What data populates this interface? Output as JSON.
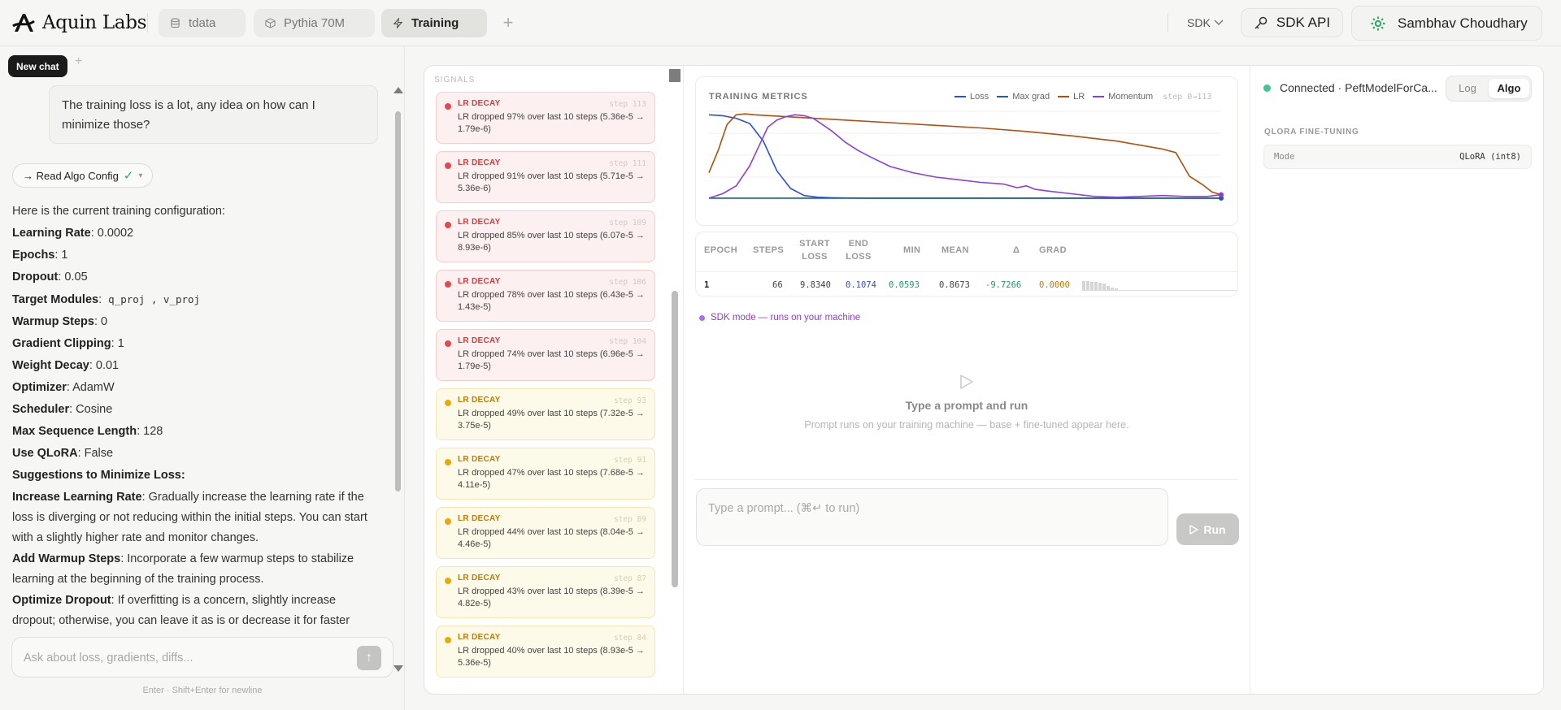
{
  "app": {
    "brand": "Aquin Labs",
    "tabs": [
      {
        "label": "tdata",
        "icon": "database-icon"
      },
      {
        "label": "Pythia 70M",
        "icon": "cube-icon"
      },
      {
        "label": "Training",
        "icon": "bolt-icon"
      }
    ],
    "tab_add": "+",
    "sdk_dropdown": "SDK",
    "sdk_api": "SDK API",
    "user_name": "Sambhav Choudhary"
  },
  "chat": {
    "new_chat": "New chat",
    "new_plus": "+",
    "user_message": "The training loss is a lot, any idea on how can I minimize those?",
    "tool_call": {
      "label": "→ Read Algo Config",
      "status": "✓",
      "chevron": "▾"
    },
    "intro": "Here is the current training configuration:",
    "config": [
      {
        "k": "Learning Rate",
        "v": ": 0.0002"
      },
      {
        "k": "Epochs",
        "v": ": 1"
      },
      {
        "k": "Dropout",
        "v": ": 0.05"
      },
      {
        "k": "Target Modules",
        "v": ":"
      },
      {
        "k": "Warmup Steps",
        "v": ": 0"
      },
      {
        "k": "Gradient Clipping",
        "v": ": 1"
      },
      {
        "k": "Weight Decay",
        "v": ": 0.01"
      },
      {
        "k": "Optimizer",
        "v": ": AdamW"
      },
      {
        "k": "Scheduler",
        "v": ": Cosine"
      },
      {
        "k": "Max Sequence Length",
        "v": ": 128"
      },
      {
        "k": "Use QLoRA",
        "v": ": False"
      }
    ],
    "target_modules_code": "q_proj , v_proj",
    "suggestions_heading": "Suggestions to Minimize Loss:",
    "suggestions": [
      {
        "k": "Increase Learning Rate",
        "v": ": Gradually increase the learning rate if the loss is diverging or not reducing within the initial steps. You can start with a slightly higher rate and monitor changes."
      },
      {
        "k": "Add Warmup Steps",
        "v": ": Incorporate a few warmup steps to stabilize learning at the beginning of the training process."
      },
      {
        "k": "Optimize Dropout",
        "v": ": If overfitting is a concern, slightly increase dropout; otherwise, you can leave it as is or decrease it for faster"
      }
    ],
    "input_placeholder": "Ask about loss, gradients, diffs...",
    "send": "↑",
    "hint": "Enter · Shift+Enter for newline"
  },
  "signals": {
    "title": "SIGNALS",
    "items": [
      {
        "kind": "LR DECAY",
        "step": "step 113",
        "msg": "LR dropped 97% over last 10 steps (5.36e-5 → 1.79e-6)",
        "level": "red"
      },
      {
        "kind": "LR DECAY",
        "step": "step 111",
        "msg": "LR dropped 91% over last 10 steps (5.71e-5 → 5.36e-6)",
        "level": "red"
      },
      {
        "kind": "LR DECAY",
        "step": "step 109",
        "msg": "LR dropped 85% over last 10 steps (6.07e-5 → 8.93e-6)",
        "level": "red"
      },
      {
        "kind": "LR DECAY",
        "step": "step 106",
        "msg": "LR dropped 78% over last 10 steps (6.43e-5 → 1.43e-5)",
        "level": "red"
      },
      {
        "kind": "LR DECAY",
        "step": "step 104",
        "msg": "LR dropped 74% over last 10 steps (6.96e-5 → 1.79e-5)",
        "level": "red"
      },
      {
        "kind": "LR DECAY",
        "step": "step 93",
        "msg": "LR dropped 49% over last 10 steps (7.32e-5 → 3.75e-5)",
        "level": "yellow"
      },
      {
        "kind": "LR DECAY",
        "step": "step 91",
        "msg": "LR dropped 47% over last 10 steps (7.68e-5 → 4.11e-5)",
        "level": "yellow"
      },
      {
        "kind": "LR DECAY",
        "step": "step 89",
        "msg": "LR dropped 44% over last 10 steps (8.04e-5 → 4.46e-5)",
        "level": "yellow"
      },
      {
        "kind": "LR DECAY",
        "step": "step 87",
        "msg": "LR dropped 43% over last 10 steps (8.39e-5 → 4.82e-5)",
        "level": "yellow"
      },
      {
        "kind": "LR DECAY",
        "step": "step 84",
        "msg": "LR dropped 40% over last 10 steps (8.93e-5 → 5.36e-5)",
        "level": "yellow"
      }
    ]
  },
  "metrics": {
    "title": "TRAINING METRICS",
    "step_range": "step 0→113",
    "table": {
      "headers": [
        "EPOCH",
        "STEPS",
        "START LOSS",
        "END LOSS",
        "MIN",
        "MEAN",
        "Δ",
        "GRAD"
      ],
      "row": {
        "epoch": "1",
        "steps": "66",
        "start_loss": "9.8340",
        "end_loss": "0.1074",
        "min": "0.0593",
        "mean": "0.8673",
        "delta": "-9.7266",
        "grad": "0.0000"
      }
    }
  },
  "chart_data": {
    "type": "line",
    "title": "TRAINING METRICS",
    "x_range": [
      0,
      113
    ],
    "y_range": [
      0,
      1
    ],
    "legend_position": "top-right",
    "grid": true,
    "series": [
      {
        "name": "Loss",
        "color": "#2f4fd6",
        "x": [
          0,
          3,
          6,
          9,
          12,
          15,
          18,
          21,
          24,
          27,
          30,
          35,
          40,
          50,
          60,
          80,
          100,
          113
        ],
        "values": [
          0.96,
          0.95,
          0.92,
          0.86,
          0.66,
          0.32,
          0.12,
          0.04,
          0.02,
          0.015,
          0.012,
          0.01,
          0.01,
          0.01,
          0.01,
          0.01,
          0.01,
          0.01
        ]
      },
      {
        "name": "Max grad",
        "color": "#1f5f99",
        "x": [
          0,
          10,
          20,
          40,
          60,
          80,
          100,
          113
        ],
        "values": [
          0.01,
          0.01,
          0.01,
          0.01,
          0.01,
          0.01,
          0.01,
          0.01
        ]
      },
      {
        "name": "LR",
        "color": "#b34f0c",
        "x": [
          0,
          2,
          4,
          6,
          8,
          10,
          20,
          30,
          40,
          50,
          60,
          70,
          80,
          90,
          100,
          103,
          106,
          109,
          111,
          113
        ],
        "values": [
          0.3,
          0.55,
          0.85,
          0.96,
          0.97,
          0.96,
          0.93,
          0.9,
          0.87,
          0.84,
          0.81,
          0.77,
          0.72,
          0.66,
          0.57,
          0.53,
          0.26,
          0.16,
          0.08,
          0.05
        ]
      },
      {
        "name": "Momentum",
        "color": "#8c3fe0",
        "x": [
          0,
          3,
          6,
          9,
          11,
          13,
          15,
          17,
          19,
          21,
          23,
          25,
          27,
          30,
          33,
          36,
          40,
          45,
          50,
          55,
          60,
          65,
          68,
          70,
          72,
          75,
          80,
          85,
          90,
          95,
          100,
          105,
          110,
          113
        ],
        "values": [
          0.01,
          0.06,
          0.15,
          0.38,
          0.6,
          0.82,
          0.9,
          0.94,
          0.96,
          0.95,
          0.92,
          0.85,
          0.78,
          0.65,
          0.55,
          0.47,
          0.37,
          0.3,
          0.25,
          0.22,
          0.19,
          0.17,
          0.13,
          0.15,
          0.11,
          0.09,
          0.06,
          0.03,
          0.02,
          0.03,
          0.04,
          0.03,
          0.03,
          0.05
        ]
      }
    ]
  },
  "sdk_mode": "SDK mode — runs on your machine",
  "empty_state": {
    "title": "Type a prompt and run",
    "subtitle": "Prompt runs on your training machine — base + fine-tuned appear here."
  },
  "prompt": {
    "placeholder": "Type a prompt... (⌘↵ to run)",
    "run": "Run"
  },
  "right": {
    "connection": "Connected · PeftModelForCa...",
    "seg": {
      "log": "Log",
      "algo": "Algo"
    },
    "algo_title": "QLORA FINE-TUNING",
    "mode_key": "Mode",
    "mode_val": "QLoRA (int8)"
  },
  "colors": {
    "accent_purple": "#8c3fd8",
    "connected": "#3fc694",
    "signal_red": "#e5484d",
    "signal_yellow": "#e9a90b"
  }
}
